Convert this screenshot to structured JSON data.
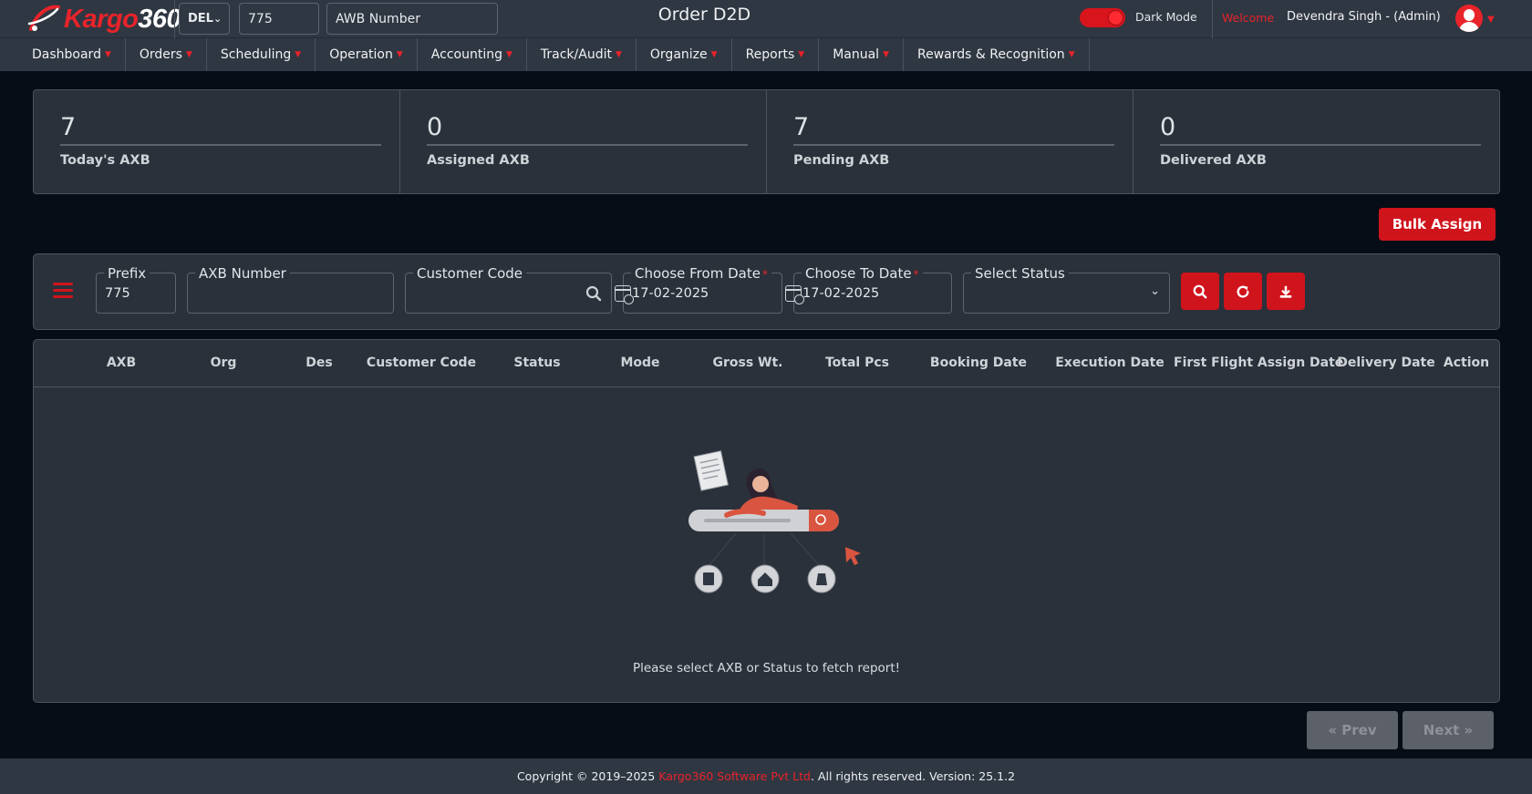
{
  "app": {
    "logo_prefix": "Kargo",
    "logo_suffix": "360",
    "station": "DEL",
    "prefix_value": "775",
    "awb_placeholder": "AWB Number",
    "page_title": "Order D2D",
    "dark_mode_label": "Dark Mode",
    "welcome_label": "Welcome",
    "user_name": "Devendra Singh - (Admin)"
  },
  "nav": [
    {
      "label": "Dashboard"
    },
    {
      "label": "Orders"
    },
    {
      "label": "Scheduling"
    },
    {
      "label": "Operation"
    },
    {
      "label": "Accounting"
    },
    {
      "label": "Track/Audit"
    },
    {
      "label": "Organize"
    },
    {
      "label": "Reports"
    },
    {
      "label": "Manual"
    },
    {
      "label": "Rewards & Recognition"
    }
  ],
  "stats": [
    {
      "value": "7",
      "label": "Today's AXB"
    },
    {
      "value": "0",
      "label": "Assigned AXB"
    },
    {
      "value": "7",
      "label": "Pending AXB"
    },
    {
      "value": "0",
      "label": "Delivered AXB"
    }
  ],
  "bulk_assign_label": "Bulk Assign",
  "filters": {
    "prefix_label": "Prefix",
    "prefix_value": "775",
    "axb_label": "AXB Number",
    "axb_value": "",
    "customer_label": "Customer Code",
    "customer_value": "",
    "from_label": "Choose From Date",
    "from_value": "17-02-2025",
    "to_label": "Choose To Date",
    "to_value": "17-02-2025",
    "status_label": "Select Status",
    "status_value": "",
    "required_mark": "*"
  },
  "table": {
    "columns": [
      "AXB",
      "Org",
      "Des",
      "Customer Code",
      "Status",
      "Mode",
      "Gross Wt.",
      "Total Pcs",
      "Booking Date",
      "Execution Date",
      "First Flight Assign Date",
      "Delivery Date",
      "Action"
    ],
    "rows": [],
    "empty_message": "Please select AXB or Status to fetch report!"
  },
  "pager": {
    "prev_label": "« Prev",
    "next_label": "Next »"
  },
  "footer": {
    "prefix": "Copyright © 2019–2025 ",
    "company": "Kargo360 Software Pvt Ltd",
    "suffix": ". All rights reserved. Version: 25.1.2"
  },
  "colors": {
    "accent": "#d0141c",
    "background": "#070d16",
    "panel": "#2a313b",
    "bar": "#2f3742"
  }
}
